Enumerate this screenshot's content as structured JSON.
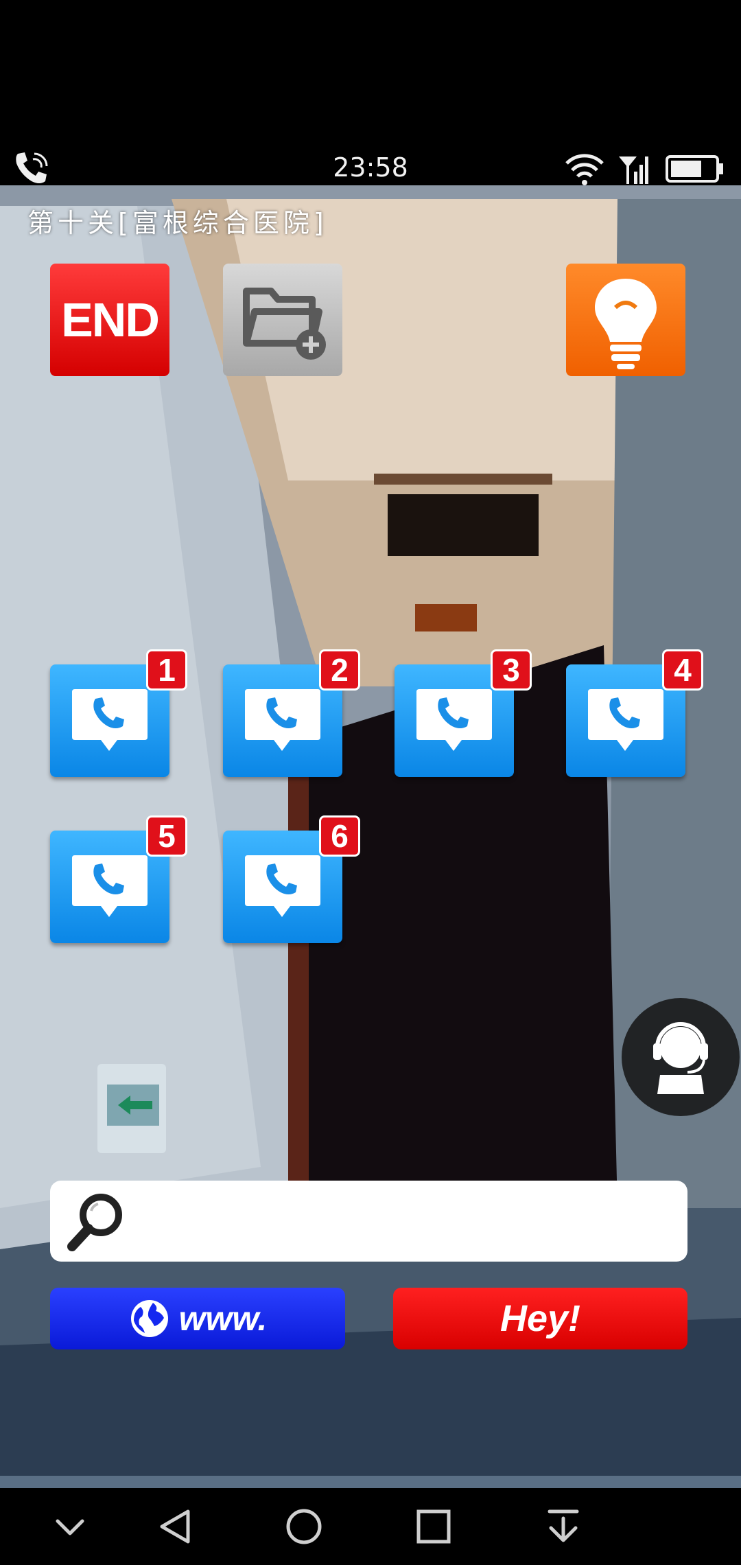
{
  "status_bar": {
    "time": "23:58",
    "icons": [
      "call-icon",
      "wifi-icon",
      "signal-icon",
      "battery-icon"
    ]
  },
  "level": {
    "title": "第十关[富根综合医院]"
  },
  "toolbar": {
    "end_label": "END",
    "folder_icon": "folder-add-icon",
    "hint_icon": "lightbulb-icon"
  },
  "call_tiles": [
    {
      "badge": "1"
    },
    {
      "badge": "2"
    },
    {
      "badge": "3"
    },
    {
      "badge": "4"
    },
    {
      "badge": "5"
    },
    {
      "badge": "6"
    }
  ],
  "operator": {
    "icon": "operator-headset-icon"
  },
  "search": {
    "placeholder": "",
    "value": ""
  },
  "actions": {
    "www_label": "www.",
    "hey_label": "Hey!"
  },
  "nav_bar": {
    "icons": [
      "chevron-down-icon",
      "back-icon",
      "home-icon",
      "recents-icon",
      "download-icon"
    ]
  },
  "colors": {
    "end": "#e00000",
    "hint": "#f47a1a",
    "call_tile": "#1a96f0",
    "badge": "#e0101a",
    "www": "#1428f0",
    "hey": "#ee0a0a"
  }
}
